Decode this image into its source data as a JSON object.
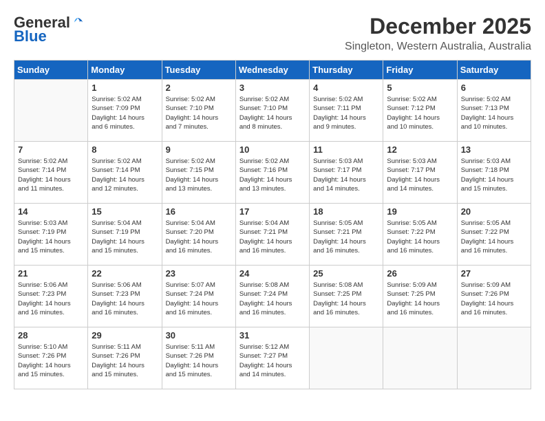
{
  "header": {
    "logo_general": "General",
    "logo_blue": "Blue",
    "month": "December 2025",
    "location": "Singleton, Western Australia, Australia"
  },
  "days_of_week": [
    "Sunday",
    "Monday",
    "Tuesday",
    "Wednesday",
    "Thursday",
    "Friday",
    "Saturday"
  ],
  "weeks": [
    [
      {
        "day": "",
        "info": ""
      },
      {
        "day": "1",
        "info": "Sunrise: 5:02 AM\nSunset: 7:09 PM\nDaylight: 14 hours\nand 6 minutes."
      },
      {
        "day": "2",
        "info": "Sunrise: 5:02 AM\nSunset: 7:10 PM\nDaylight: 14 hours\nand 7 minutes."
      },
      {
        "day": "3",
        "info": "Sunrise: 5:02 AM\nSunset: 7:10 PM\nDaylight: 14 hours\nand 8 minutes."
      },
      {
        "day": "4",
        "info": "Sunrise: 5:02 AM\nSunset: 7:11 PM\nDaylight: 14 hours\nand 9 minutes."
      },
      {
        "day": "5",
        "info": "Sunrise: 5:02 AM\nSunset: 7:12 PM\nDaylight: 14 hours\nand 10 minutes."
      },
      {
        "day": "6",
        "info": "Sunrise: 5:02 AM\nSunset: 7:13 PM\nDaylight: 14 hours\nand 10 minutes."
      }
    ],
    [
      {
        "day": "7",
        "info": ""
      },
      {
        "day": "8",
        "info": "Sunrise: 5:02 AM\nSunset: 7:14 PM\nDaylight: 14 hours\nand 12 minutes."
      },
      {
        "day": "9",
        "info": "Sunrise: 5:02 AM\nSunset: 7:15 PM\nDaylight: 14 hours\nand 13 minutes."
      },
      {
        "day": "10",
        "info": "Sunrise: 5:02 AM\nSunset: 7:16 PM\nDaylight: 14 hours\nand 13 minutes."
      },
      {
        "day": "11",
        "info": "Sunrise: 5:03 AM\nSunset: 7:17 PM\nDaylight: 14 hours\nand 14 minutes."
      },
      {
        "day": "12",
        "info": "Sunrise: 5:03 AM\nSunset: 7:17 PM\nDaylight: 14 hours\nand 14 minutes."
      },
      {
        "day": "13",
        "info": "Sunrise: 5:03 AM\nSunset: 7:18 PM\nDaylight: 14 hours\nand 15 minutes."
      }
    ],
    [
      {
        "day": "14",
        "info": ""
      },
      {
        "day": "15",
        "info": "Sunrise: 5:04 AM\nSunset: 7:19 PM\nDaylight: 14 hours\nand 15 minutes."
      },
      {
        "day": "16",
        "info": "Sunrise: 5:04 AM\nSunset: 7:20 PM\nDaylight: 14 hours\nand 16 minutes."
      },
      {
        "day": "17",
        "info": "Sunrise: 5:04 AM\nSunset: 7:21 PM\nDaylight: 14 hours\nand 16 minutes."
      },
      {
        "day": "18",
        "info": "Sunrise: 5:05 AM\nSunset: 7:21 PM\nDaylight: 14 hours\nand 16 minutes."
      },
      {
        "day": "19",
        "info": "Sunrise: 5:05 AM\nSunset: 7:22 PM\nDaylight: 14 hours\nand 16 minutes."
      },
      {
        "day": "20",
        "info": "Sunrise: 5:05 AM\nSunset: 7:22 PM\nDaylight: 14 hours\nand 16 minutes."
      }
    ],
    [
      {
        "day": "21",
        "info": ""
      },
      {
        "day": "22",
        "info": "Sunrise: 5:06 AM\nSunset: 7:23 PM\nDaylight: 14 hours\nand 16 minutes."
      },
      {
        "day": "23",
        "info": "Sunrise: 5:07 AM\nSunset: 7:24 PM\nDaylight: 14 hours\nand 16 minutes."
      },
      {
        "day": "24",
        "info": "Sunrise: 5:08 AM\nSunset: 7:24 PM\nDaylight: 14 hours\nand 16 minutes."
      },
      {
        "day": "25",
        "info": "Sunrise: 5:08 AM\nSunset: 7:25 PM\nDaylight: 14 hours\nand 16 minutes."
      },
      {
        "day": "26",
        "info": "Sunrise: 5:09 AM\nSunset: 7:25 PM\nDaylight: 14 hours\nand 16 minutes."
      },
      {
        "day": "27",
        "info": "Sunrise: 5:09 AM\nSunset: 7:26 PM\nDaylight: 14 hours\nand 16 minutes."
      }
    ],
    [
      {
        "day": "28",
        "info": "Sunrise: 5:10 AM\nSunset: 7:26 PM\nDaylight: 14 hours\nand 15 minutes."
      },
      {
        "day": "29",
        "info": "Sunrise: 5:11 AM\nSunset: 7:26 PM\nDaylight: 14 hours\nand 15 minutes."
      },
      {
        "day": "30",
        "info": "Sunrise: 5:11 AM\nSunset: 7:26 PM\nDaylight: 14 hours\nand 15 minutes."
      },
      {
        "day": "31",
        "info": "Sunrise: 5:12 AM\nSunset: 7:27 PM\nDaylight: 14 hours\nand 14 minutes."
      },
      {
        "day": "",
        "info": ""
      },
      {
        "day": "",
        "info": ""
      },
      {
        "day": "",
        "info": ""
      }
    ]
  ],
  "week7_sunday_info": "Sunrise: 5:02 AM\nSunset: 7:14 PM\nDaylight: 14 hours\nand 11 minutes.",
  "week14_sunday_info": "Sunrise: 5:03 AM\nSunset: 7:19 PM\nDaylight: 14 hours\nand 15 minutes.",
  "week21_sunday_info": "Sunrise: 5:06 AM\nSunset: 7:23 PM\nDaylight: 14 hours\nand 16 minutes."
}
